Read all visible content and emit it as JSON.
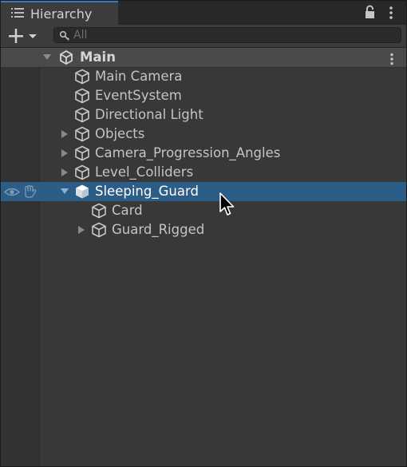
{
  "window": {
    "tab_title": "Hierarchy",
    "tab_icon": "list-icon",
    "lock_icon": "lock-icon",
    "menu_icon": "kebab-icon"
  },
  "toolbar": {
    "add_button_icon": "plus-dropdown-icon",
    "search_placeholder": "All"
  },
  "scene": {
    "name": "Main",
    "icon": "unity-icon"
  },
  "items": [
    {
      "label": "Main Camera",
      "has_children": false
    },
    {
      "label": "EventSystem",
      "has_children": false
    },
    {
      "label": "Directional Light",
      "has_children": false
    },
    {
      "label": "Objects",
      "has_children": true
    },
    {
      "label": "Camera_Progression_Angles",
      "has_children": true
    },
    {
      "label": "Level_Colliders",
      "has_children": true
    },
    {
      "label": "Sleeping_Guard",
      "has_children": true,
      "expanded": true,
      "selected": true
    },
    {
      "label": "Card",
      "has_children": false
    },
    {
      "label": "Guard_Rigged",
      "has_children": true
    }
  ],
  "colors": {
    "background": "#383838",
    "selection": "#2c5d87",
    "tab_accent": "#3a79bb",
    "text": "#c4c4c4"
  }
}
